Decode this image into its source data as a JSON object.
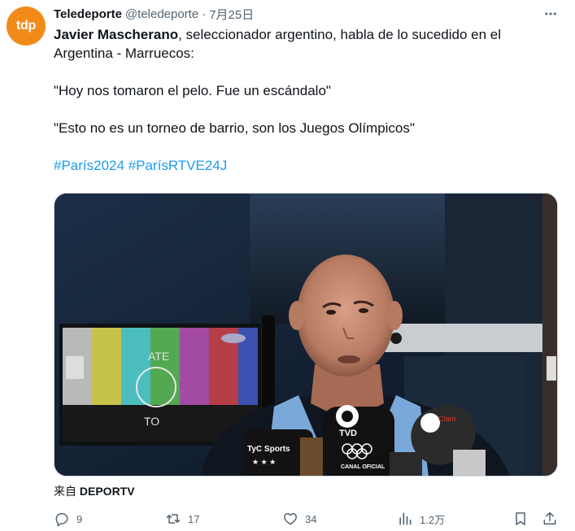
{
  "tweet": {
    "avatar_text": "tdp",
    "display_name": "Teledeporte",
    "handle": "@teledeporte",
    "separator": "·",
    "date": "7月25日",
    "text": {
      "line1_bold": "Javier Mascherano",
      "line1_rest": ", seleccionador argentino, habla de lo sucedido en el Argentina - Marruecos:",
      "quote1": "\"Hoy nos tomaron el pelo. Fue un escándalo\"",
      "quote2": "\"Esto no es un torneo de barrio, son los Juegos Olímpicos\"",
      "hashtag1": "#París2024",
      "hashtag2": "#ParísRTVE24J"
    },
    "media": {
      "mic1_brand": "TyC Sports",
      "mic2_label": "TVD",
      "mic2_sub": "CANAL OFICIAL",
      "mic3_brand": "Claro",
      "tv_text1": "ATE",
      "tv_text2": "TO"
    },
    "source_prefix": "来自",
    "source_name": "DEPORTV",
    "stats": {
      "replies": "9",
      "retweets": "17",
      "likes": "34",
      "views": "1.2万"
    },
    "icons": {
      "more": "more-icon",
      "reply": "reply-icon",
      "retweet": "retweet-icon",
      "like": "heart-icon",
      "views": "views-icon",
      "bookmark": "bookmark-icon",
      "share": "share-icon"
    },
    "colors": {
      "avatar_bg": "#f28a1a",
      "hashtag": "#1d9bf0",
      "secondary_text": "#536471"
    }
  }
}
